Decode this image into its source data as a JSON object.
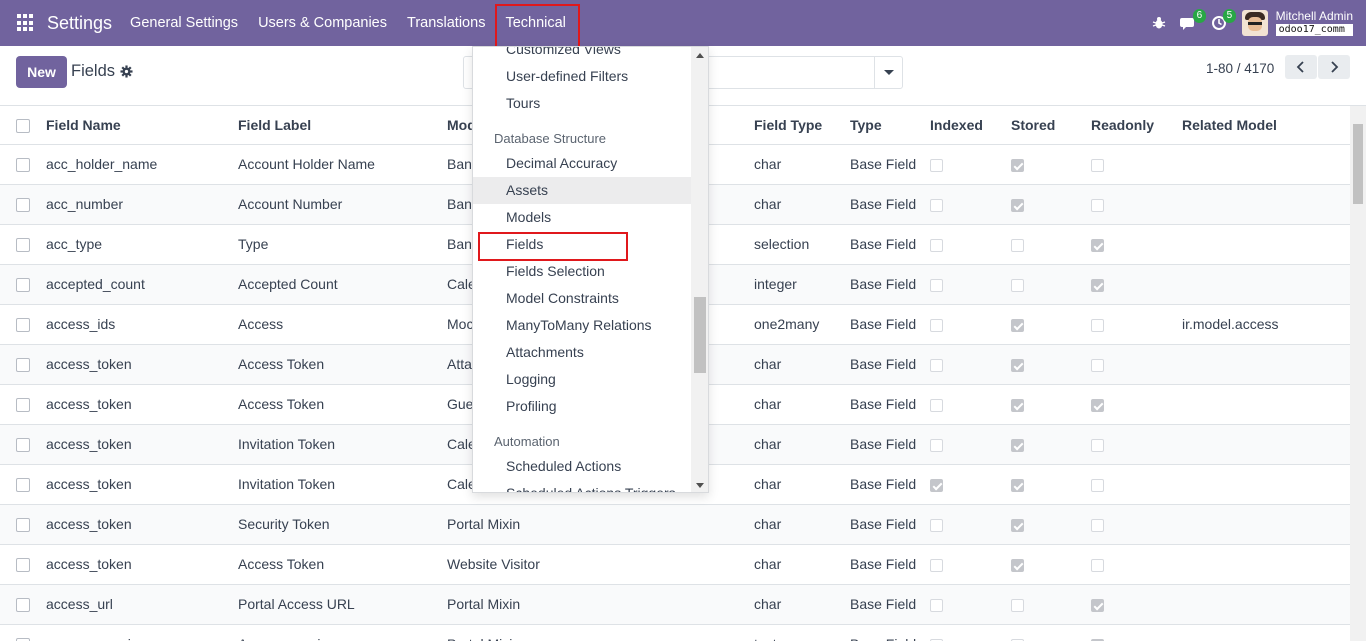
{
  "navbar": {
    "brand": "Settings",
    "menu": [
      "General Settings",
      "Users & Companies",
      "Translations",
      "Technical"
    ],
    "chat_badge": "6",
    "activity_badge": "5",
    "user_name": "Mitchell Admin",
    "db_name": "odoo17_comm"
  },
  "control": {
    "new_label": "New",
    "title": "Fields",
    "pager": "1-80 / 4170"
  },
  "table": {
    "headers": [
      "Field Name",
      "Field Label",
      "Mod",
      "Field Type",
      "Type",
      "Indexed",
      "Stored",
      "Readonly",
      "Related Model"
    ],
    "rows": [
      {
        "name": "acc_holder_name",
        "label": "Account Holder Name",
        "model": "Banl",
        "ftype": "char",
        "type": "Base Field",
        "indexed": false,
        "stored": true,
        "readonly": false,
        "related": ""
      },
      {
        "name": "acc_number",
        "label": "Account Number",
        "model": "Banl",
        "ftype": "char",
        "type": "Base Field",
        "indexed": false,
        "stored": true,
        "readonly": false,
        "related": ""
      },
      {
        "name": "acc_type",
        "label": "Type",
        "model": "Banl",
        "ftype": "selection",
        "type": "Base Field",
        "indexed": false,
        "stored": false,
        "readonly": true,
        "related": ""
      },
      {
        "name": "accepted_count",
        "label": "Accepted Count",
        "model": "Cale",
        "ftype": "integer",
        "type": "Base Field",
        "indexed": false,
        "stored": false,
        "readonly": true,
        "related": ""
      },
      {
        "name": "access_ids",
        "label": "Access",
        "model": "Moc",
        "ftype": "one2many",
        "type": "Base Field",
        "indexed": false,
        "stored": true,
        "readonly": false,
        "related": "ir.model.access"
      },
      {
        "name": "access_token",
        "label": "Access Token",
        "model": "Atta",
        "ftype": "char",
        "type": "Base Field",
        "indexed": false,
        "stored": true,
        "readonly": false,
        "related": ""
      },
      {
        "name": "access_token",
        "label": "Access Token",
        "model": "Gue",
        "ftype": "char",
        "type": "Base Field",
        "indexed": false,
        "stored": true,
        "readonly": true,
        "related": ""
      },
      {
        "name": "access_token",
        "label": "Invitation Token",
        "model": "Cale",
        "ftype": "char",
        "type": "Base Field",
        "indexed": false,
        "stored": true,
        "readonly": false,
        "related": ""
      },
      {
        "name": "access_token",
        "label": "Invitation Token",
        "model": "Cale",
        "ftype": "char",
        "type": "Base Field",
        "indexed": true,
        "stored": true,
        "readonly": false,
        "related": ""
      },
      {
        "name": "access_token",
        "label": "Security Token",
        "model": "Portal Mixin",
        "ftype": "char",
        "type": "Base Field",
        "indexed": false,
        "stored": true,
        "readonly": false,
        "related": ""
      },
      {
        "name": "access_token",
        "label": "Access Token",
        "model": "Website Visitor",
        "ftype": "char",
        "type": "Base Field",
        "indexed": false,
        "stored": true,
        "readonly": false,
        "related": ""
      },
      {
        "name": "access_url",
        "label": "Portal Access URL",
        "model": "Portal Mixin",
        "ftype": "char",
        "type": "Base Field",
        "indexed": false,
        "stored": false,
        "readonly": true,
        "related": ""
      },
      {
        "name": "access_warning",
        "label": "Access warning",
        "model": "Portal Mixin",
        "ftype": "text",
        "type": "Base Field",
        "indexed": false,
        "stored": false,
        "readonly": true,
        "related": ""
      }
    ]
  },
  "dropdown": {
    "items_top": [
      "Customized Views",
      "User-defined Filters",
      "Tours"
    ],
    "section_db": "Database Structure",
    "items_db": [
      "Decimal Accuracy",
      "Assets",
      "Models",
      "Fields",
      "Fields Selection",
      "Model Constraints",
      "ManyToMany Relations",
      "Attachments",
      "Logging",
      "Profiling"
    ],
    "section_auto": "Automation",
    "items_auto": [
      "Scheduled Actions",
      "Scheduled Actions Triggers"
    ]
  }
}
